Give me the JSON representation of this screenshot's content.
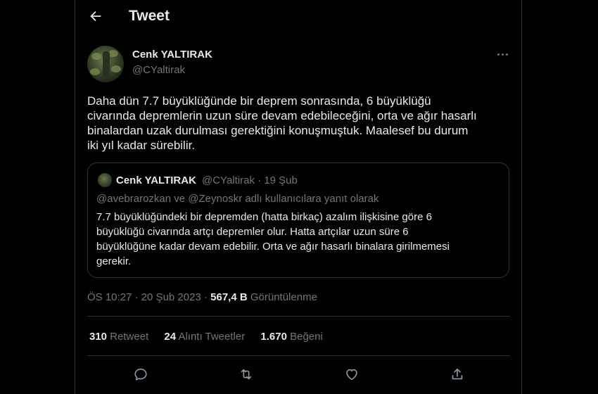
{
  "header": {
    "title": "Tweet"
  },
  "author": {
    "name": "Cenk YALTIRAK",
    "handle": "@CYaltirak"
  },
  "tweet": {
    "lines": [
      "Daha dün 7.7 büyüklüğünde bir deprem sonrasında, 6 büyüklüğü",
      "civarında depremlerin uzun süre devam edebileceğini, orta ve ağır hasarlı",
      "binalardan uzak durulması gerektiğini konuşmuştuk. Maalesef bu durum",
      "iki yıl kadar sürebilir."
    ]
  },
  "quote": {
    "name": "Cenk YALTIRAK",
    "meta": "@CYaltirak · 19 Şub",
    "reply_to": "@avebrarozkan ve @Zeynoskr adlı kullanıcılara yanıt olarak",
    "lines": [
      "7.7 büyüklüğündeki bir depremden (hatta birkaç) azalım ilişkisine göre 6",
      "büyüklüğü civarında artçı depremler olur. Hatta artçılar uzun süre 6",
      "büyüklüğüne kadar devam edebilir. Orta ve ağır hasarlı binalara girilmemesi",
      "gerekir."
    ]
  },
  "timestamp": {
    "datetime": "ÖS 10:27 · 20 Şub 2023",
    "separator": " · ",
    "views_count": "567,4 B",
    "views_label": "Görüntülenme"
  },
  "stats": {
    "retweets_count": "310",
    "retweets_label": "Retweet",
    "quotes_count": "24",
    "quotes_label": "Alıntı Tweetler",
    "likes_count": "1.670",
    "likes_label": "Beğeni"
  },
  "icons": {
    "back": "arrow-left-icon",
    "more": "more-horizontal-icon",
    "reply": "reply-icon",
    "retweet": "retweet-icon",
    "like": "heart-icon",
    "share": "share-icon"
  },
  "colors": {
    "background": "#000000",
    "text": "#e7e9ea",
    "muted": "#71767b",
    "border": "#2f3336"
  }
}
